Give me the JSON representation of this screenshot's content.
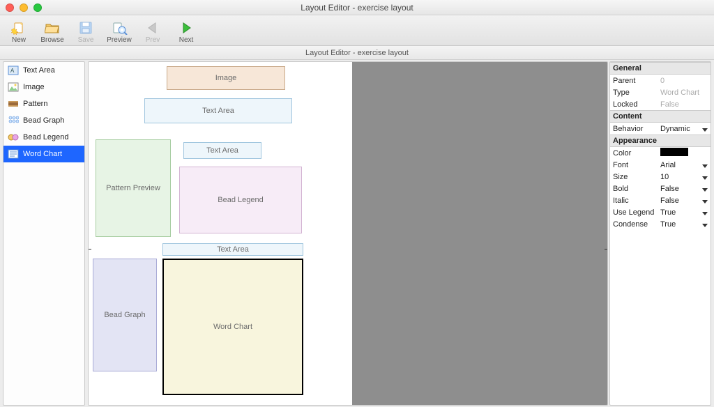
{
  "window": {
    "title": "Layout Editor - exercise layout"
  },
  "subheader": {
    "title": "Layout Editor - exercise layout"
  },
  "toolbar": {
    "new": "New",
    "browse": "Browse",
    "save": "Save",
    "preview": "Preview",
    "prev": "Prev",
    "next": "Next"
  },
  "palette": {
    "items": [
      {
        "label": "Text Area"
      },
      {
        "label": "Image"
      },
      {
        "label": "Pattern"
      },
      {
        "label": "Bead Graph"
      },
      {
        "label": "Bead Legend"
      },
      {
        "label": "Word Chart"
      }
    ],
    "selected_index": 5
  },
  "canvas": {
    "boxes": {
      "image": {
        "label": "Image"
      },
      "textarea1": {
        "label": "Text Area"
      },
      "textarea2": {
        "label": "Text Area"
      },
      "patternprev": {
        "label": "Pattern Preview"
      },
      "beadlegend": {
        "label": "Bead Legend"
      },
      "textarea3": {
        "label": "Text Area"
      },
      "beadgraph": {
        "label": "Bead Graph"
      },
      "wordchart": {
        "label": "Word Chart"
      }
    }
  },
  "props": {
    "sections": {
      "general": "General",
      "content": "Content",
      "appearance": "Appearance"
    },
    "general": {
      "parent_k": "Parent",
      "parent_v": "0",
      "type_k": "Type",
      "type_v": "Word Chart",
      "locked_k": "Locked",
      "locked_v": "False"
    },
    "content": {
      "behavior_k": "Behavior",
      "behavior_v": "Dynamic"
    },
    "appearance": {
      "color_k": "Color",
      "color_v": "#000000",
      "font_k": "Font",
      "font_v": "Arial",
      "size_k": "Size",
      "size_v": "10",
      "bold_k": "Bold",
      "bold_v": "False",
      "italic_k": "Italic",
      "italic_v": "False",
      "uselegend_k": "Use Legend",
      "uselegend_v": "True",
      "condense_k": "Condense",
      "condense_v": "True"
    }
  }
}
